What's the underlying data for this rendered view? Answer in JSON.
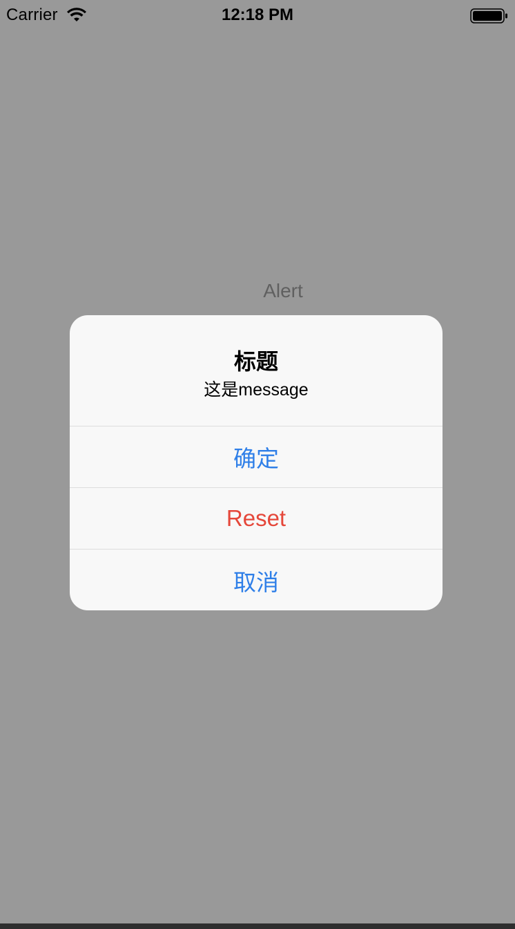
{
  "status_bar": {
    "carrier": "Carrier",
    "time": "12:18 PM",
    "wifi_icon": "wifi-icon",
    "battery_icon": "battery-icon"
  },
  "background": {
    "label": "Alert"
  },
  "alert": {
    "title": "标题",
    "message": "这是message",
    "actions": [
      {
        "label": "确定",
        "color": "#2f7fe8"
      },
      {
        "label": "Reset",
        "color": "#e5473a"
      },
      {
        "label": "取消",
        "color": "#2f7fe8"
      }
    ]
  },
  "colors": {
    "screen_background": "#999999",
    "alert_background": "#f8f8f8",
    "accent_blue": "#2f7fe8",
    "destructive_red": "#e5473a"
  }
}
